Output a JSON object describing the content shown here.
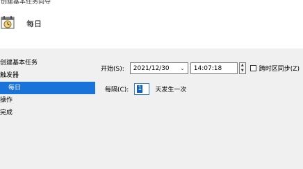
{
  "window": {
    "title": "创建基本任务向导"
  },
  "header": {
    "title": "每日",
    "icon": "calendar-clock-icon"
  },
  "steps": [
    {
      "label": "创建基本任务",
      "active": false,
      "sub": false
    },
    {
      "label": "触发器",
      "active": false,
      "sub": false
    },
    {
      "label": "每日",
      "active": true,
      "sub": true
    },
    {
      "label": "操作",
      "active": false,
      "sub": false
    },
    {
      "label": "完成",
      "active": false,
      "sub": false
    }
  ],
  "start": {
    "label": "开始(S):",
    "date": "2021/12/30",
    "time": "14:07:18",
    "sync_label": "跨时区同步(Z)",
    "sync_checked": false
  },
  "recur": {
    "label": "每隔(C):",
    "value": "1",
    "suffix": "天发生一次"
  },
  "colors": {
    "accent": "#1a73d9",
    "panel": "#f0f0f0"
  }
}
